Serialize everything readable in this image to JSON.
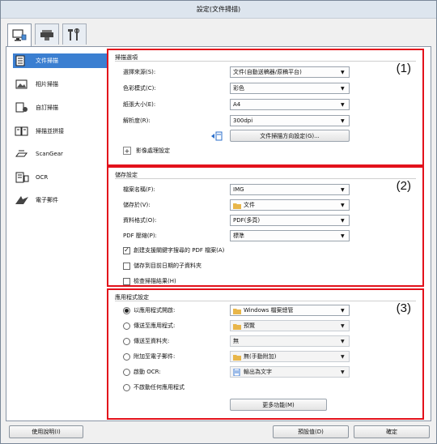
{
  "window": {
    "title": "設定(文件掃描)"
  },
  "tabs": [
    {
      "icon": "scan-computer-icon"
    },
    {
      "icon": "scanner-icon"
    },
    {
      "icon": "tools-icon"
    }
  ],
  "sidebar": {
    "items": [
      {
        "label": "文件掃描",
        "icon": "document-scan-icon"
      },
      {
        "label": "相片掃描",
        "icon": "photo-scan-icon"
      },
      {
        "label": "自訂掃描",
        "icon": "custom-scan-icon"
      },
      {
        "label": "掃描並拼接",
        "icon": "stitch-icon"
      },
      {
        "label": "ScanGear",
        "icon": "scangear-icon"
      },
      {
        "label": "OCR",
        "icon": "ocr-icon"
      },
      {
        "label": "電子郵件",
        "icon": "email-icon"
      }
    ]
  },
  "scan_options": {
    "title": "掃描選項",
    "number": "(1)",
    "source_label": "選擇來源(S):",
    "source_value": "文件(自動送稿器/原稿平台)",
    "color_label": "色彩模式(C):",
    "color_value": "彩色",
    "paper_label": "紙張大小(E):",
    "paper_value": "A4",
    "resolution_label": "解析度(R):",
    "resolution_value": "300dpi",
    "orientation_button": "文件掃描方向設定(G)...",
    "image_processing_label": "影像處理設定",
    "expand_symbol": "+"
  },
  "save_settings": {
    "title": "儲存設定",
    "number": "(2)",
    "filename_label": "檔案名稱(F):",
    "filename_value": "IMG",
    "savein_label": "儲存於(V):",
    "savein_value": "文件",
    "format_label": "資料格式(O):",
    "format_value": "PDF(多頁)",
    "compression_label": "PDF 壓縮(P):",
    "compression_value": "標準",
    "searchable_pdf": "創建支援關鍵字搜尋的 PDF 檔案(A)",
    "searchable_pdf_checked": true,
    "subfolder": "儲存到目前日期的子資料夾",
    "subfolder_checked": false,
    "check_result": "檢查掃描結果(H)",
    "check_result_checked": false
  },
  "app_settings": {
    "title": "應用程式設定",
    "number": "(3)",
    "open_with_label": "以應用程式開啟:",
    "open_with_value": "Windows 檔案總管",
    "send_app_label": "傳送至應用程式:",
    "send_app_value": "預覽",
    "send_folder_label": "傳送至資料夾:",
    "send_folder_value": "無",
    "attach_email_label": "附加至電子郵件:",
    "attach_email_value": "無(手動附加)",
    "start_ocr_label": "啟動 OCR:",
    "start_ocr_value": "輸出為文字",
    "no_app_label": "不啟動任何應用程式",
    "selected_option": "open_with",
    "more_functions_button": "更多功能(M)"
  },
  "footer": {
    "help_button": "使用說明(I)",
    "defaults_button": "預設值(D)",
    "ok_button": "確定"
  },
  "colors": {
    "section_border": "#e3111b",
    "sidebar_selected": "#3b7fd1"
  }
}
